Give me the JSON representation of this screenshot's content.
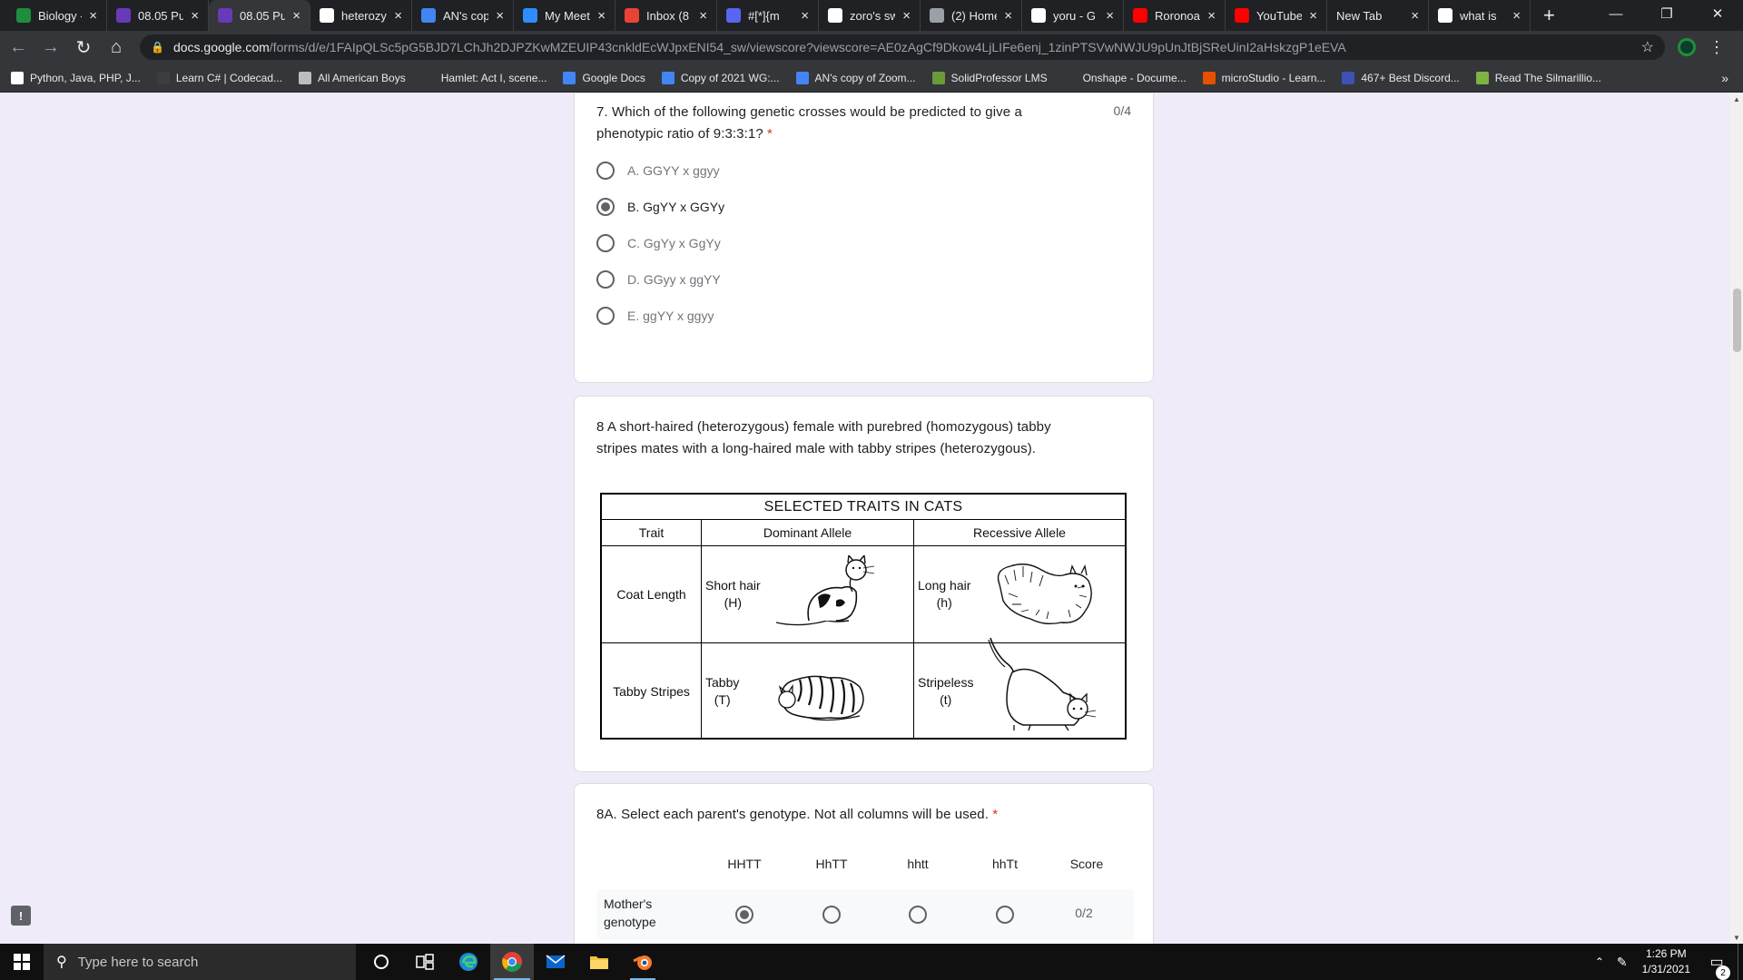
{
  "browser": {
    "tabs": [
      {
        "label": "Biology -",
        "icon": "classroom-icon",
        "color": "#1e8e3e",
        "active": false
      },
      {
        "label": "08.05 Pu",
        "icon": "forms-icon",
        "color": "#673ab7",
        "active": false
      },
      {
        "label": "08.05 Pu",
        "icon": "forms-icon",
        "color": "#673ab7",
        "active": true
      },
      {
        "label": "heterozy",
        "icon": "google-icon",
        "color": "#ffffff",
        "active": false
      },
      {
        "label": "AN's cop",
        "icon": "docs-icon",
        "color": "#4285f4",
        "active": false
      },
      {
        "label": "My Meet",
        "icon": "zoom-icon",
        "color": "#2d8cff",
        "active": false
      },
      {
        "label": "Inbox (8",
        "icon": "gmail-icon",
        "color": "#ea4335",
        "active": false
      },
      {
        "label": "#[*]{m",
        "icon": "discord-icon",
        "color": "#5865f2",
        "active": false
      },
      {
        "label": "zoro's sw",
        "icon": "google-icon",
        "color": "#ffffff",
        "active": false
      },
      {
        "label": "(2) Home",
        "icon": "page-icon",
        "color": "#9aa0a6",
        "active": false
      },
      {
        "label": "yoru - G",
        "icon": "google-icon",
        "color": "#ffffff",
        "active": false
      },
      {
        "label": "Roronoa",
        "icon": "youtube-icon",
        "color": "#ff0000",
        "active": false
      },
      {
        "label": "YouTube",
        "icon": "youtube-icon",
        "color": "#ff0000",
        "active": false
      },
      {
        "label": "New Tab",
        "icon": "",
        "color": "",
        "active": false
      },
      {
        "label": "what is",
        "icon": "google-icon",
        "color": "#ffffff",
        "active": false
      }
    ],
    "url_host": "docs.google.com",
    "url_path": "/forms/d/e/1FAIpQLSc5pG5BJD7LChJh2DJPZKwMZEUIP43cnkldEcWJpxENI54_sw/viewscore?viewscore=AE0zAgCf9Dkow4LjLIFe6enj_1zinPTSVwNWJU9pUnJtBjSReUinI2aHskzgP1eEVA",
    "bookmarks": [
      {
        "label": "Python, Java, PHP, J...",
        "icon": "google-icon",
        "color": "#ffffff"
      },
      {
        "label": "Learn C# | Codecad...",
        "icon": "codecademy-icon",
        "color": "#3c3d40"
      },
      {
        "label": "All American Boys",
        "icon": "shield-icon",
        "color": "#bdbdbd"
      },
      {
        "label": "Hamlet: Act I, scene...",
        "icon": "snowflake-icon",
        "color": "#35363a"
      },
      {
        "label": "Google Docs",
        "icon": "docs-icon",
        "color": "#4285f4"
      },
      {
        "label": "Copy of 2021 WG:...",
        "icon": "docs-icon",
        "color": "#4285f4"
      },
      {
        "label": "AN's copy of Zoom...",
        "icon": "docs-icon",
        "color": "#4285f4"
      },
      {
        "label": "SolidProfessor LMS",
        "icon": "solidprofessor-icon",
        "color": "#6a9a3a"
      },
      {
        "label": "Onshape - Docume...",
        "icon": "onshape-icon",
        "color": "#35363a"
      },
      {
        "label": "microStudio - Learn...",
        "icon": "microstudio-icon",
        "color": "#e65100"
      },
      {
        "label": "467+ Best Discord...",
        "icon": "a-icon",
        "color": "#3f51b5"
      },
      {
        "label": "Read The Silmarillio...",
        "icon": "bookmark-icon",
        "color": "#7cb342"
      }
    ],
    "bookmarks_more": "»"
  },
  "q7": {
    "title_line1": "7. Which of the following genetic crosses would be predicted to give a",
    "title_line2": "phenotypic ratio of 9:3:3:1?",
    "required": "*",
    "score": "0/4",
    "options": [
      {
        "label": "A. GGYY x ggyy",
        "selected": false
      },
      {
        "label": "B. GgYY x GGYy",
        "selected": true
      },
      {
        "label": "C. GgYy x GgYy",
        "selected": false
      },
      {
        "label": "D. GGyy x ggYY",
        "selected": false
      },
      {
        "label": "E. ggYY x ggyy",
        "selected": false
      }
    ]
  },
  "q8": {
    "title_line1": "8 A short-haired (heterozygous) female with purebred (homozygous) tabby",
    "title_line2": "stripes mates with a long-haired male with tabby stripes (heterozygous).",
    "table": {
      "title": "SELECTED TRAITS IN CATS",
      "headers": [
        "Trait",
        "Dominant Allele",
        "Recessive Allele"
      ],
      "rows": [
        {
          "trait": "Coat Length",
          "dominant_1": "Short hair",
          "dominant_2": "(H)",
          "recessive_1": "Long hair",
          "recessive_2": "(h)"
        },
        {
          "trait": "Tabby Stripes",
          "dominant_1": "Tabby",
          "dominant_2": "(T)",
          "recessive_1": "Stripeless",
          "recessive_2": "(t)"
        }
      ]
    }
  },
  "q8a": {
    "title": "8A. Select each parent's genotype. Not all columns will be used.",
    "required": "*",
    "columns": [
      "HHTT",
      "HhTT",
      "hhtt",
      "hhTt",
      "Score"
    ],
    "rows": [
      {
        "label_1": "Mother's",
        "label_2": "genotype",
        "selected_index": 0,
        "score": "0/2"
      }
    ]
  },
  "taskbar": {
    "search_placeholder": "Type here to search",
    "time": "1:26 PM",
    "date": "1/31/2021",
    "notifications": "2"
  }
}
